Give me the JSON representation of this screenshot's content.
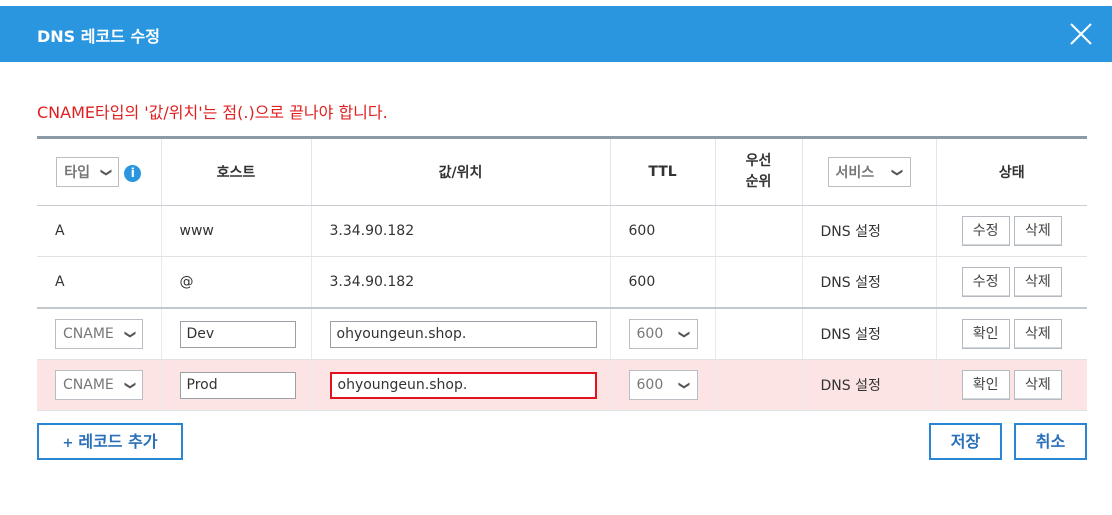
{
  "dialog": {
    "title": "DNS 레코드 수정"
  },
  "warning": "CNAME타입의 '값/위치'는 점(.)으로 끝나야 합니다.",
  "columns": {
    "type_filter": "타입",
    "host": "호스트",
    "value": "값/위치",
    "ttl": "TTL",
    "priority_line1": "우선",
    "priority_line2": "순위",
    "service_filter": "서비스",
    "status": "상태"
  },
  "rows": [
    {
      "type": "A",
      "host": "www",
      "value": "3.34.90.182",
      "ttl": "600",
      "priority": "",
      "service": "DNS 설정",
      "action1": "수정",
      "action2": "삭제"
    },
    {
      "type": "A",
      "host": "@",
      "value": "3.34.90.182",
      "ttl": "600",
      "priority": "",
      "service": "DNS 설정",
      "action1": "수정",
      "action2": "삭제"
    },
    {
      "type": "CNAME",
      "host": "Dev",
      "value": "ohyoungeun.shop.",
      "ttl": "600",
      "priority": "",
      "service": "DNS 설정",
      "action1": "확인",
      "action2": "삭제"
    },
    {
      "type": "CNAME",
      "host": "Prod",
      "value": "ohyoungeun.shop.",
      "ttl": "600",
      "priority": "",
      "service": "DNS 설정",
      "action1": "확인",
      "action2": "삭제"
    }
  ],
  "footer": {
    "add_record": "레코드 추가",
    "add_icon": "+",
    "save": "저장",
    "cancel": "취소"
  },
  "colors": {
    "header": "#2a96e0",
    "error_text": "#e02020",
    "error_row": "#fde4e4",
    "button_border": "#2a86d4"
  }
}
